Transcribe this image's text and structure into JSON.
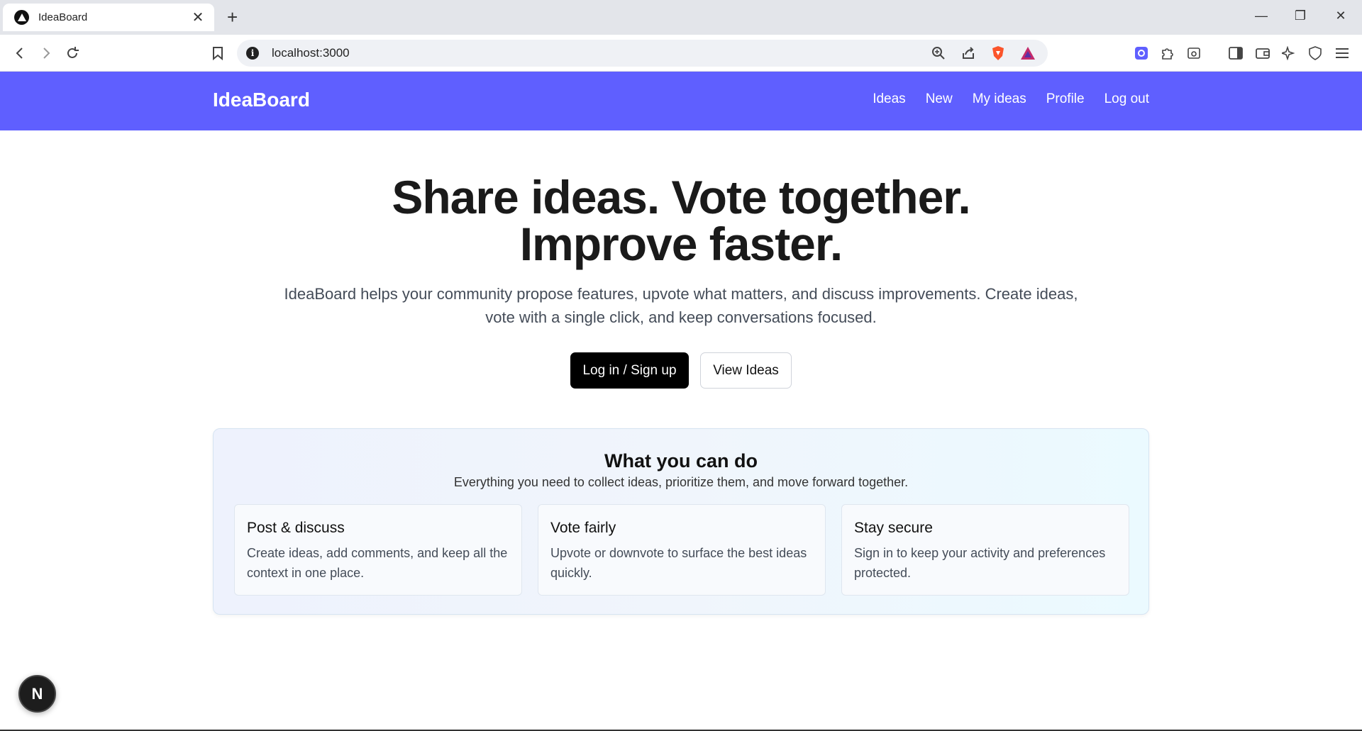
{
  "browser": {
    "tab_title": "IdeaBoard",
    "tab_close": "✕",
    "new_tab": "+",
    "url": "localhost:3000",
    "window_controls": {
      "minimize": "—",
      "restore": "❐",
      "close": "✕"
    }
  },
  "header": {
    "brand": "IdeaBoard",
    "nav": [
      "Ideas",
      "New",
      "My ideas",
      "Profile",
      "Log out"
    ]
  },
  "hero": {
    "title_line1": "Share ideas. Vote together.",
    "title_line2": "Improve faster.",
    "subtitle": "IdeaBoard helps your community propose features, upvote what matters, and discuss improvements. Create ideas, vote with a single click, and keep conversations focused.",
    "primary_button": "Log in / Sign up",
    "secondary_button": "View Ideas"
  },
  "features": {
    "title": "What you can do",
    "subtitle": "Everything you need to collect ideas, prioritize them, and move forward together.",
    "cards": [
      {
        "title": "Post & discuss",
        "desc": "Create ideas, add comments, and keep all the context in one place."
      },
      {
        "title": "Vote fairly",
        "desc": "Upvote or downvote to surface the best ideas quickly."
      },
      {
        "title": "Stay secure",
        "desc": "Sign in to keep your activity and preferences protected."
      }
    ]
  },
  "dev_badge": "N",
  "colors": {
    "brand": "#5f5fff",
    "primary_button": "#000000"
  }
}
